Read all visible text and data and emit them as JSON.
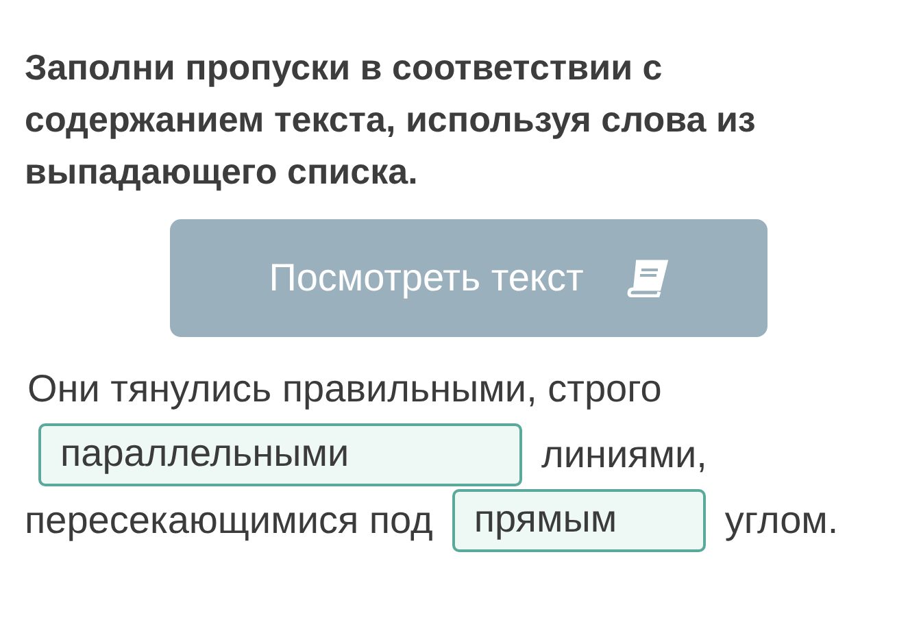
{
  "instruction": "Заполни пропуски в соответствии с содержанием текста, используя слова из выпадающего списка.",
  "view_text_button": {
    "label": "Посмотреть текст"
  },
  "sentence_lines": [
    [
      {
        "kind": "text",
        "text": "Они тянулись правильными, строго"
      }
    ],
    [
      {
        "kind": "dropdown",
        "value": "параллельными"
      },
      {
        "kind": "text",
        "text": "линиями,"
      }
    ],
    [
      {
        "kind": "text",
        "text": "пересекающимися под"
      },
      {
        "kind": "dropdown",
        "value": "прямым"
      },
      {
        "kind": "text",
        "text": "углом."
      }
    ]
  ]
}
